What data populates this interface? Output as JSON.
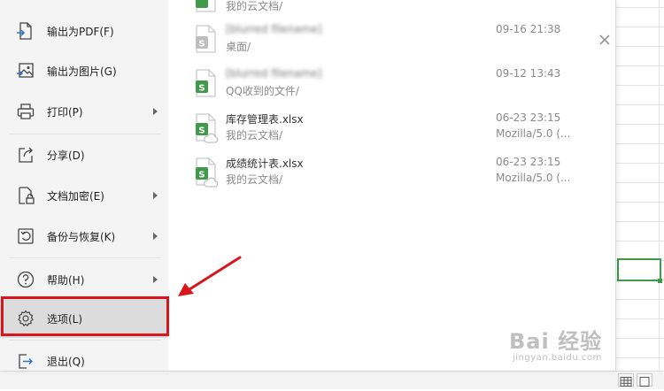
{
  "menu": {
    "items": [
      {
        "key": "export_pdf",
        "label": "输出为PDF(F)",
        "icon": "export-pdf-icon",
        "submenu": false
      },
      {
        "key": "export_image",
        "label": "输出为图片(G)",
        "icon": "image-icon",
        "submenu": false
      },
      {
        "key": "print",
        "label": "打印(P)",
        "icon": "printer-icon",
        "submenu": true
      },
      {
        "key": "share",
        "label": "分享(D)",
        "icon": "share-icon",
        "submenu": false
      },
      {
        "key": "encrypt",
        "label": "文档加密(E)",
        "icon": "lock-document-icon",
        "submenu": true
      },
      {
        "key": "backup",
        "label": "备份与恢复(K)",
        "icon": "backup-restore-icon",
        "submenu": true
      },
      {
        "key": "help",
        "label": "帮助(H)",
        "icon": "help-icon",
        "submenu": true
      },
      {
        "key": "options",
        "label": "选项(L)",
        "icon": "gear-icon",
        "submenu": false,
        "selected": true
      },
      {
        "key": "exit",
        "label": "退出(Q)",
        "icon": "exit-icon",
        "submenu": false
      }
    ]
  },
  "recent_files": [
    {
      "name": "",
      "path": "我的云文档/",
      "time": "",
      "extra": "",
      "icon": "spreadsheet-file-icon",
      "partial": true
    },
    {
      "name": "[blurred filename]",
      "path": "桌面/",
      "time": "09-16 21:38",
      "extra": "",
      "icon": "spreadsheet-file-icon-gray",
      "blurred": true
    },
    {
      "name": "[blurred filename]",
      "path": "QQ收到的文件/",
      "time": "09-12 13:43",
      "extra": "",
      "icon": "spreadsheet-file-icon",
      "blurred": true
    },
    {
      "name": "库存管理表.xlsx",
      "path": "我的云文档/",
      "time": "06-23 23:15",
      "extra": "Mozilla/5.0 (...",
      "icon": "cloud-spreadsheet-file-icon"
    },
    {
      "name": "成绩统计表.xlsx",
      "path": "我的云文档/",
      "time": "06-23 23:15",
      "extra": "Mozilla/5.0 (...",
      "icon": "cloud-spreadsheet-file-icon"
    }
  ],
  "watermark": {
    "main": "Bai 经验",
    "sub": "jingyan.baidu.com"
  },
  "colors": {
    "accent_green": "#3f9a4a",
    "highlight_red": "#d9161b",
    "sidebar_bg": "#f4f4f4",
    "selected_bg": "#dcdcdc"
  }
}
